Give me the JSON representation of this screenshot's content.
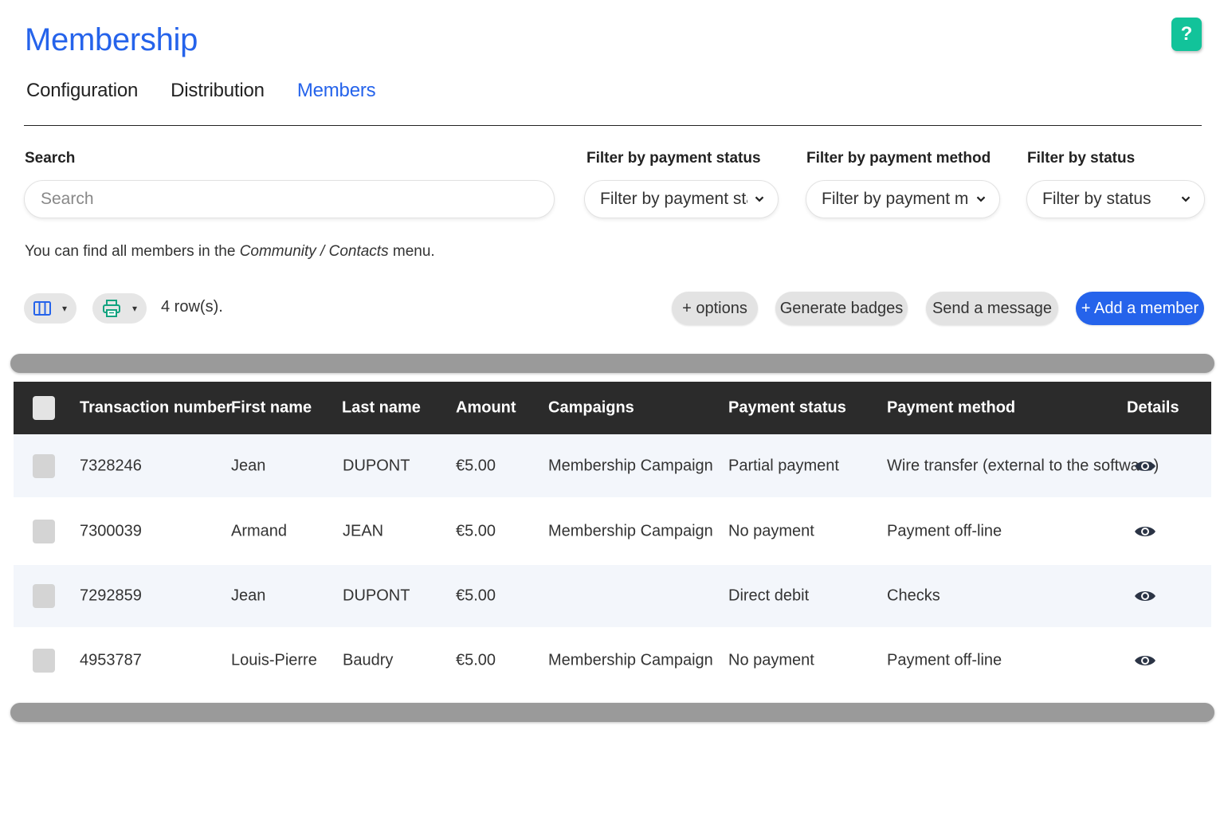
{
  "app": {
    "title": "Membership",
    "help_label": "?"
  },
  "tabs": [
    {
      "label": "Configuration",
      "active": false
    },
    {
      "label": "Distribution",
      "active": false
    },
    {
      "label": "Members",
      "active": true
    }
  ],
  "filters": {
    "search_label": "Search",
    "search_placeholder": "Search",
    "payment_status_label": "Filter by payment status",
    "payment_status_value": "Filter by payment statu",
    "payment_method_label": "Filter by payment method",
    "payment_method_value": "Filter by payment meth",
    "status_label": "Filter by status",
    "status_value": "Filter by status"
  },
  "info": {
    "prefix": "You can find all members in the ",
    "menu_path": "Community / Contacts",
    "suffix": " menu."
  },
  "toolbar": {
    "columns_icon": "columns-icon",
    "print_icon": "printer-icon",
    "caret": "▾",
    "row_count": "4 row(s).",
    "options_label": "+ options",
    "badges_label": "Generate badges",
    "message_label": "Send a message",
    "add_member_label": "+ Add a member"
  },
  "table": {
    "headers": {
      "transaction": "Transaction number",
      "first_name": "First name",
      "last_name": "Last name",
      "amount": "Amount",
      "campaigns": "Campaigns",
      "payment_status": "Payment status",
      "payment_method": "Payment method",
      "details": "Details"
    },
    "rows": [
      {
        "transaction": "7328246",
        "first_name": "Jean",
        "last_name": "DUPONT",
        "amount": "€5.00",
        "campaign": "Membership Campaign",
        "payment_status": "Partial payment",
        "payment_method": "Wire transfer (external to the software)",
        "details_icon": "eye-icon"
      },
      {
        "transaction": "7300039",
        "first_name": "Armand",
        "last_name": "JEAN",
        "amount": "€5.00",
        "campaign": "Membership Campaign",
        "payment_status": "No payment",
        "payment_method": "Payment off-line",
        "details_icon": "eye-icon"
      },
      {
        "transaction": "7292859",
        "first_name": "Jean",
        "last_name": "DUPONT",
        "amount": "€5.00",
        "campaign": "",
        "payment_status": "Direct debit",
        "payment_method": "Checks",
        "details_icon": "eye-icon"
      },
      {
        "transaction": "4953787",
        "first_name": "Louis-Pierre",
        "last_name": "Baudry",
        "amount": "€5.00",
        "campaign": "Membership Campaign",
        "payment_status": "No payment",
        "payment_method": "Payment off-line",
        "details_icon": "eye-icon"
      }
    ]
  },
  "colors": {
    "accent": "#2563eb",
    "help": "#12c39a",
    "header_bg": "#2b2b2b",
    "alt_row": "#f3f6fb"
  }
}
